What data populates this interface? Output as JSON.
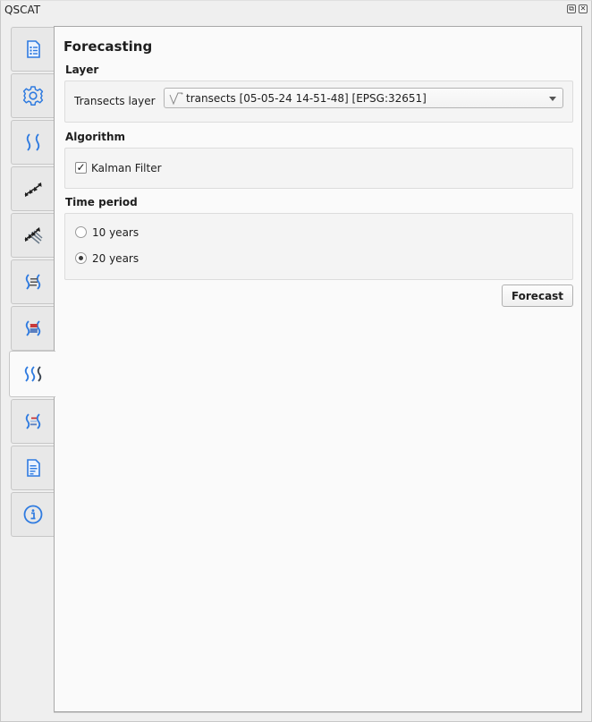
{
  "window": {
    "title": "QSCAT",
    "float_icon": "float-window-icon",
    "close_icon": "close-icon"
  },
  "tabs": [
    {
      "name": "project-settings",
      "icon": "list-document-icon",
      "active": false
    },
    {
      "name": "general-settings",
      "icon": "gear-icon",
      "active": false
    },
    {
      "name": "shorelines",
      "icon": "double-wave-icon",
      "active": false
    },
    {
      "name": "baseline",
      "icon": "arrows-icon",
      "active": false
    },
    {
      "name": "transects",
      "icon": "multi-arrows-icon",
      "active": false
    },
    {
      "name": "shoreline-change",
      "icon": "wave-bars-icon",
      "active": false
    },
    {
      "name": "area-change",
      "icon": "wave-red-blue-icon",
      "active": false
    },
    {
      "name": "forecasting",
      "icon": "triple-wave-icon",
      "active": true
    },
    {
      "name": "visualization",
      "icon": "wave-summary-icon",
      "active": false
    },
    {
      "name": "summary-reports",
      "icon": "document-icon",
      "active": false
    },
    {
      "name": "about",
      "icon": "info-icon",
      "active": false
    }
  ],
  "page": {
    "title": "Forecasting",
    "layer_group": {
      "title": "Layer",
      "transects_label": "Transects layer",
      "transects_value": "transects [05-05-24 14-51-48] [EPSG:32651]"
    },
    "algorithm_group": {
      "title": "Algorithm",
      "kalman_label": "Kalman Filter",
      "kalman_checked": true,
      "check_glyph": "✓"
    },
    "time_group": {
      "title": "Time period",
      "options": [
        {
          "label": "10 years",
          "checked": false
        },
        {
          "label": "20 years",
          "checked": true
        }
      ]
    },
    "forecast_button": "Forecast"
  },
  "colors": {
    "accent_blue": "#2f7be0",
    "accent_red": "#c9393a",
    "dark_icon": "#2b2b2b"
  }
}
